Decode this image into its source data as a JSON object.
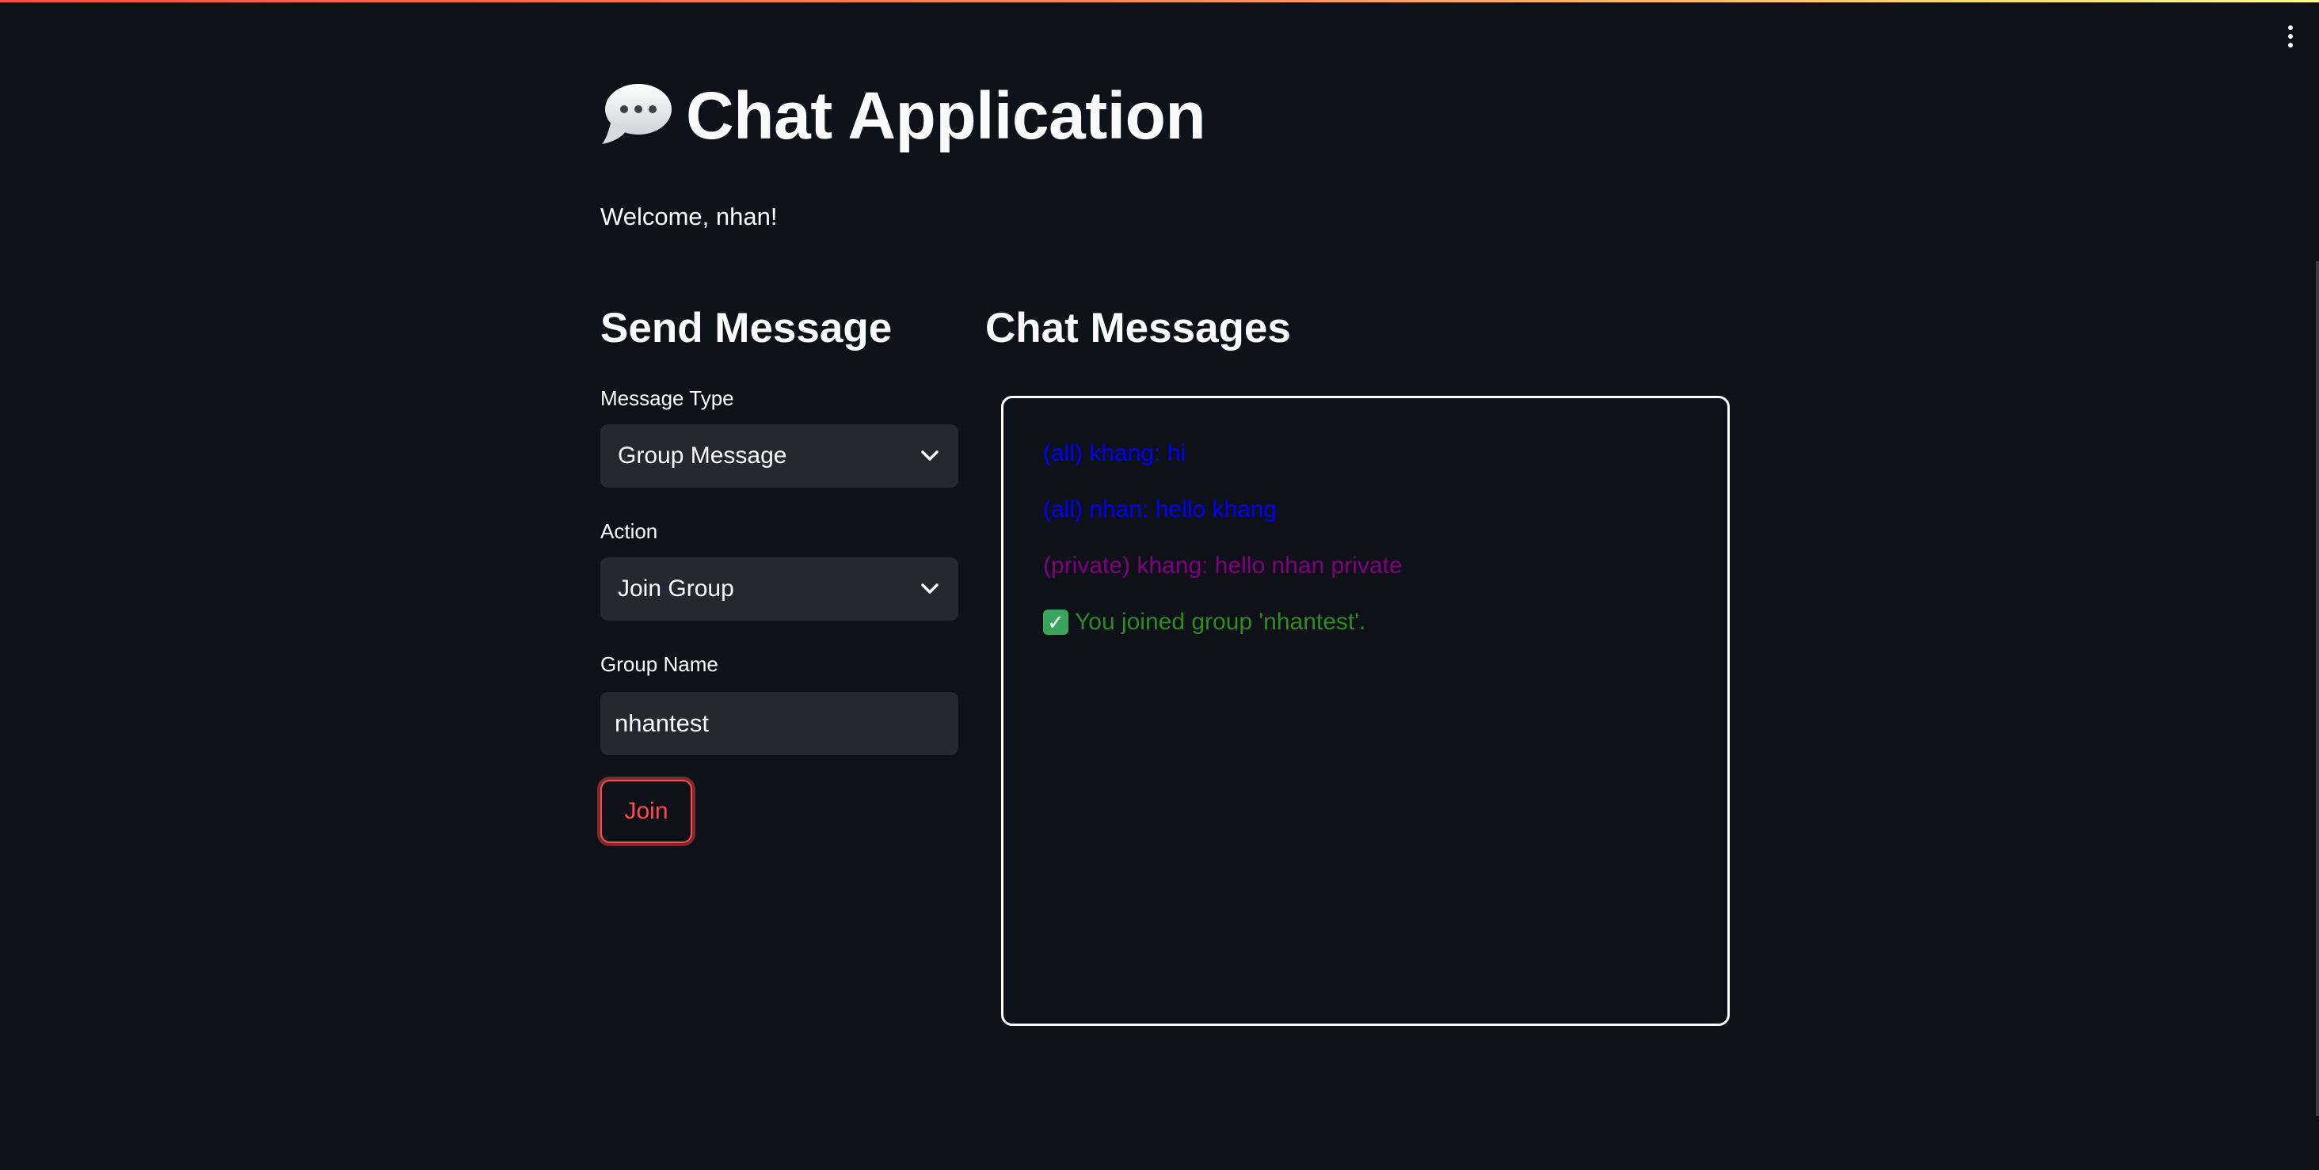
{
  "app": {
    "title": "Chat Application",
    "welcome": "Welcome, nhan!",
    "accent_color": "#ff4b4b",
    "title_icon": "speech-bubble-icon",
    "menu_icon": "kebab-menu-icon"
  },
  "send_message": {
    "title": "Send Message",
    "message_type": {
      "label": "Message Type",
      "value": "Group Message"
    },
    "action": {
      "label": "Action",
      "value": "Join Group"
    },
    "group_name": {
      "label": "Group Name",
      "value": "nhantest"
    },
    "join_button": "Join"
  },
  "chat_messages": {
    "title": "Chat Messages",
    "messages": [
      {
        "text": "(all) khang: hi",
        "color": "#0000ff"
      },
      {
        "text": "(all) nhan: hello khang",
        "color": "#0000ff"
      },
      {
        "text": "(private) khang: hello nhan private",
        "color": "#800080"
      },
      {
        "text": "You joined group 'nhantest'.",
        "color": "#2e8b22",
        "icon": "check-icon"
      }
    ]
  }
}
